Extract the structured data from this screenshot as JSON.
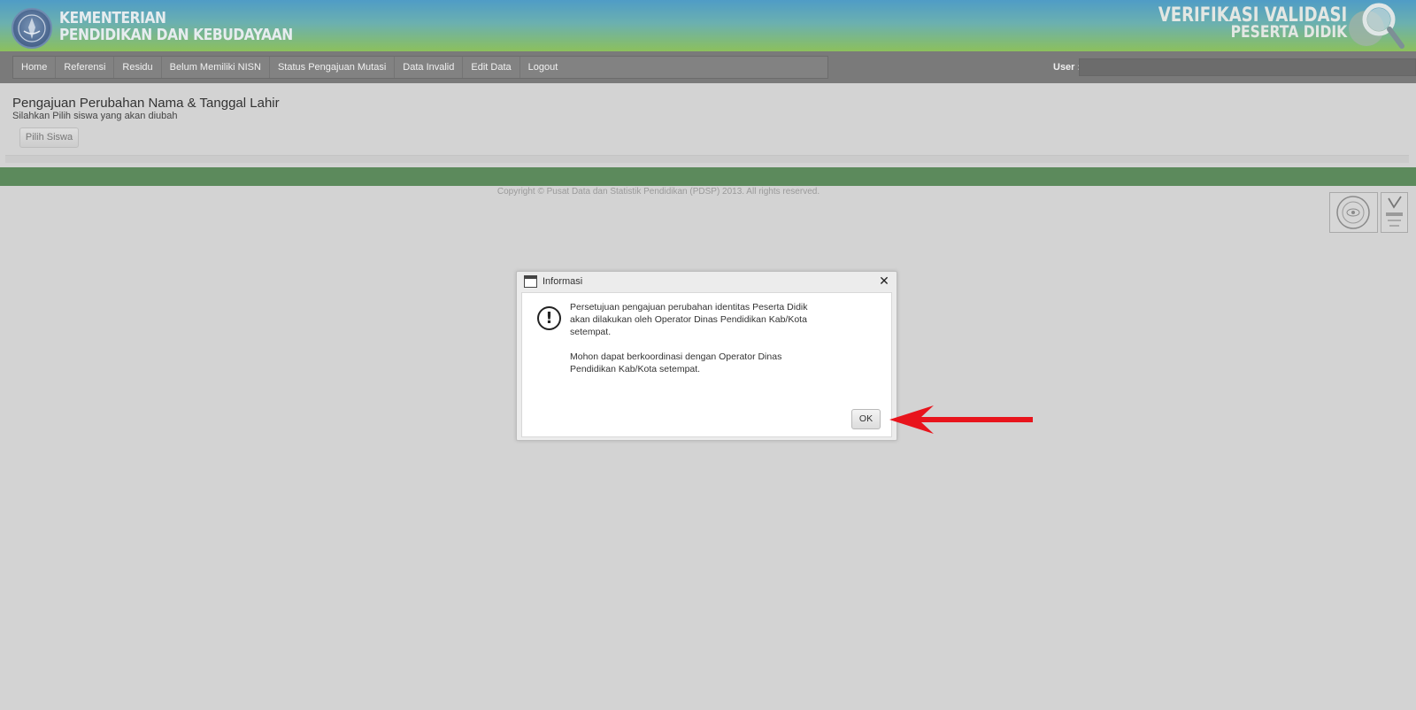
{
  "header": {
    "ministry_line1": "KEMENTERIAN",
    "ministry_line2": "PENDIDIKAN DAN KEBUDAYAAN",
    "app_line1": "VERIFIKASI VALIDASI",
    "app_line2": "PESERTA DIDIK",
    "logo_icon": "tut-wuri-handayani-logo-icon",
    "emblem_icon": "magnifier-globe-icon"
  },
  "nav": {
    "items": [
      "Home",
      "Referensi",
      "Residu",
      "Belum Memiliki NISN",
      "Status Pengajuan Mutasi",
      "Data Invalid",
      "Edit Data",
      "Logout"
    ],
    "user_label": "User :",
    "user_value": ""
  },
  "page": {
    "title": "Pengajuan Perubahan Nama & Tanggal Lahir",
    "subtitle": "Silahkan Pilih siswa yang akan diubah",
    "pilih_button": "Pilih Siswa"
  },
  "footer": {
    "copyright": "Copyright © Pusat Data dan Statistik Pendidikan (PDSP) 2013. All rights reserved.",
    "cert_icon_1": "iso-certification-seal-icon",
    "cert_icon_2": "kan-accreditation-icon"
  },
  "dialog": {
    "title": "Informasi",
    "close_icon": "close-icon",
    "warning_icon": "exclamation-icon",
    "message1": "Persetujuan pengajuan perubahan identitas Peserta Didik akan dilakukan oleh Operator Dinas Pendidikan Kab/Kota setempat.",
    "message2": "Mohon dapat berkoordinasi dengan Operator Dinas Pendidikan Kab/Kota setempat.",
    "ok_button": "OK"
  },
  "annotation": {
    "arrow_icon": "red-arrow-icon",
    "arrow_color": "#e8141c"
  },
  "colors": {
    "header_top": "#4f9cc6",
    "header_bottom": "#8cc05c",
    "nav_bg": "#7a7a7a",
    "overlay_bg": "#d3d3d3",
    "footer_band": "#5c8a5c"
  }
}
